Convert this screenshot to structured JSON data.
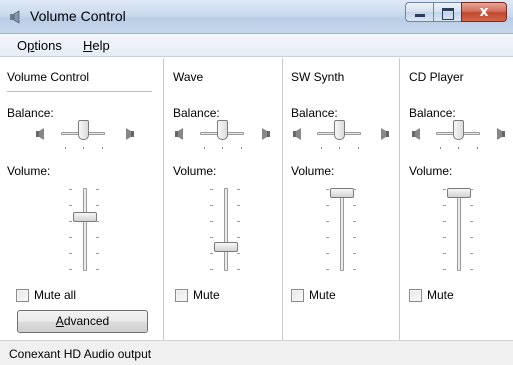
{
  "window": {
    "title": "Volume Control",
    "close_glyph": "x"
  },
  "menu": {
    "options": {
      "pre": "O",
      "key": "p",
      "post": "tions"
    },
    "help": {
      "key": "H",
      "post": "elp"
    }
  },
  "channels": [
    {
      "title": "Volume Control",
      "balance_label": "Balance:",
      "volume_label": "Volume:",
      "mute_label": "Mute all",
      "muted": false,
      "balance_value": 0.5,
      "volume_value": 0.6
    },
    {
      "title": "Wave",
      "balance_label": "Balance:",
      "volume_label": "Volume:",
      "mute_label": "Mute",
      "muted": false,
      "balance_value": 0.5,
      "volume_value": 0.25
    },
    {
      "title": "SW Synth",
      "balance_label": "Balance:",
      "volume_label": "Volume:",
      "mute_label": "Mute",
      "muted": false,
      "balance_value": 0.5,
      "volume_value": 1.0
    },
    {
      "title": "CD Player",
      "balance_label": "Balance:",
      "volume_label": "Volume:",
      "mute_label": "Mute",
      "muted": false,
      "balance_value": 0.5,
      "volume_value": 1.0
    }
  ],
  "advanced_button": {
    "key": "A",
    "post": "dvanced"
  },
  "status": {
    "text": "Conexant HD Audio output"
  },
  "icons": {
    "app": "speaker-icon",
    "balance_left": "speaker-left-icon",
    "balance_right": "speaker-right-icon"
  }
}
